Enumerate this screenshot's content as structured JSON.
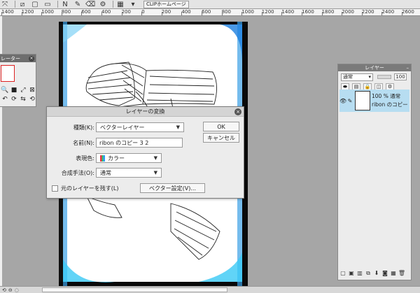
{
  "toolbar": {
    "clip_label": "CLIPホームページ"
  },
  "ruler": {
    "ticks": [
      "1400",
      "1200",
      "1000",
      "800",
      "600",
      "400",
      "200",
      "0",
      "200",
      "400",
      "600",
      "800",
      "1000",
      "1200",
      "1400",
      "1600",
      "1800",
      "2000",
      "2200",
      "2400",
      "2600"
    ]
  },
  "left_palette": {
    "title": "レーター"
  },
  "layer_panel": {
    "title": "レイヤー",
    "blend_mode": "通常",
    "opacity_value": "100",
    "layer": {
      "opacity_text": "100 % 通常",
      "name": "ribon のコピー"
    }
  },
  "dialog": {
    "title": "レイヤーの変換",
    "kind_label": "種類(K):",
    "kind_value": "ベクターレイヤー",
    "name_label": "名前(N):",
    "name_value": "ribon のコピー 3 2",
    "color_label": "表現色:",
    "color_value": "カラー",
    "blend_label": "合成手法(O):",
    "blend_value": "通常",
    "keep_original_label": "元のレイヤーを残す(L)",
    "vector_settings_label": "ベクター設定(V)...",
    "ok_label": "OK",
    "cancel_label": "キャンセル"
  }
}
